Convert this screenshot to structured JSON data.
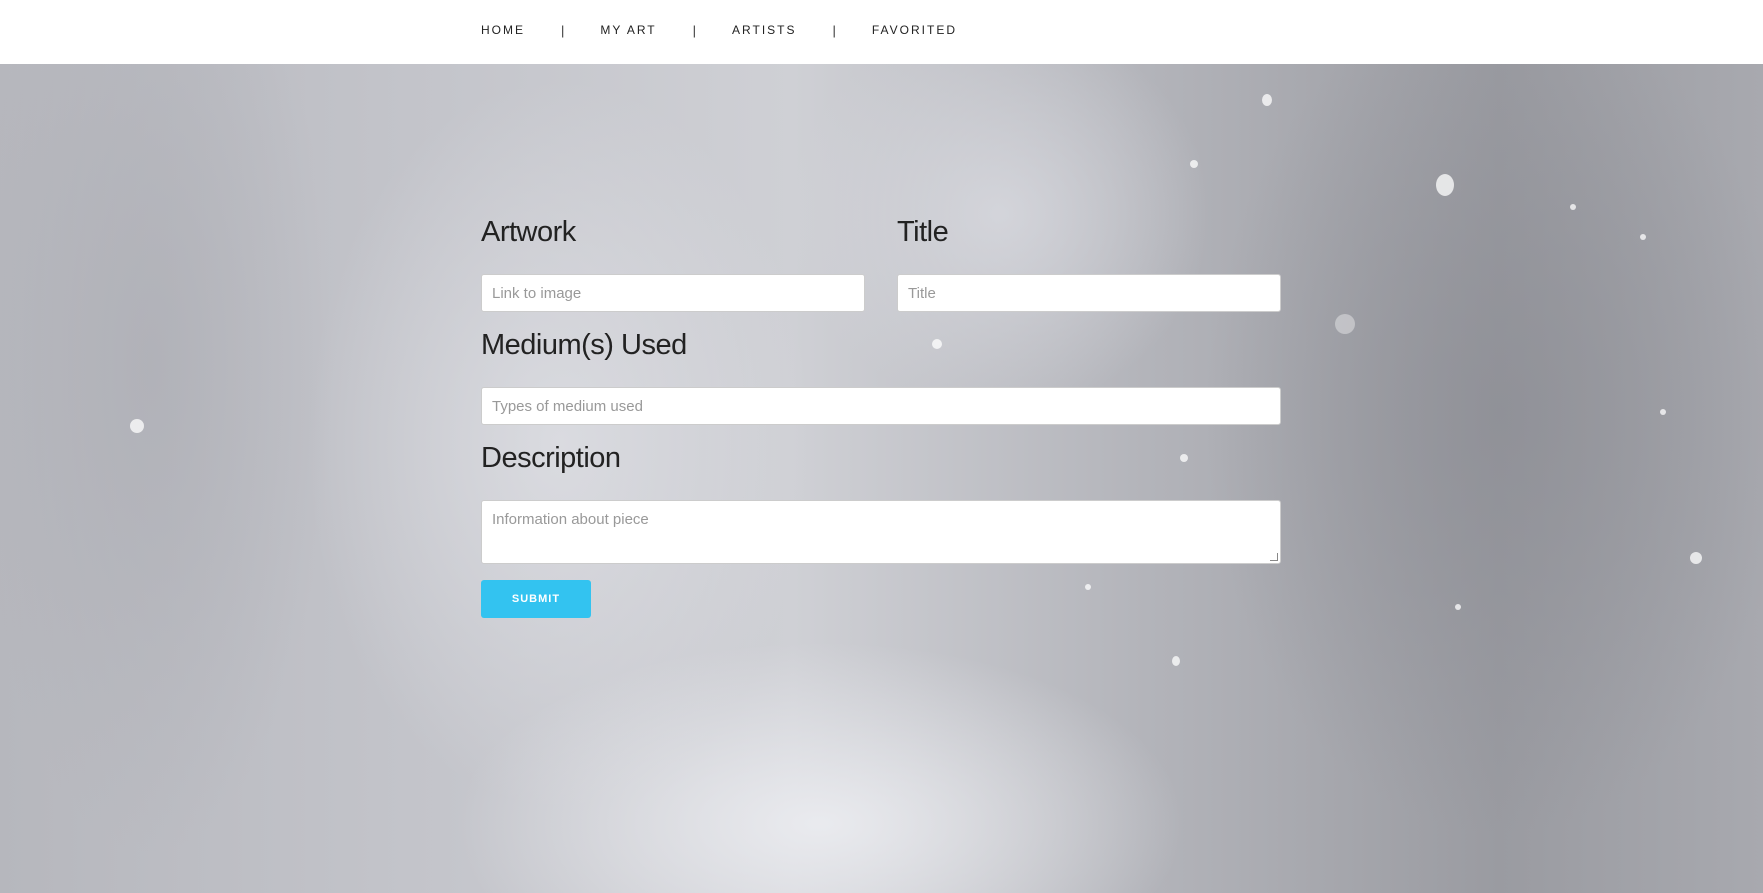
{
  "nav": {
    "items": [
      {
        "label": "HOME"
      },
      {
        "label": "MY ART"
      },
      {
        "label": "ARTISTS"
      },
      {
        "label": "FAVORITED"
      }
    ],
    "separator": "|"
  },
  "form": {
    "artwork": {
      "label": "Artwork",
      "placeholder": "Link to image"
    },
    "title": {
      "label": "Title",
      "placeholder": "Title"
    },
    "medium": {
      "label": "Medium(s) Used",
      "placeholder": "Types of medium used"
    },
    "description": {
      "label": "Description",
      "placeholder": "Information about piece"
    },
    "submit_label": "SUBMIT"
  },
  "colors": {
    "accent": "#33c3f0",
    "nav_background": "#ffffff",
    "label_text": "#222222"
  }
}
